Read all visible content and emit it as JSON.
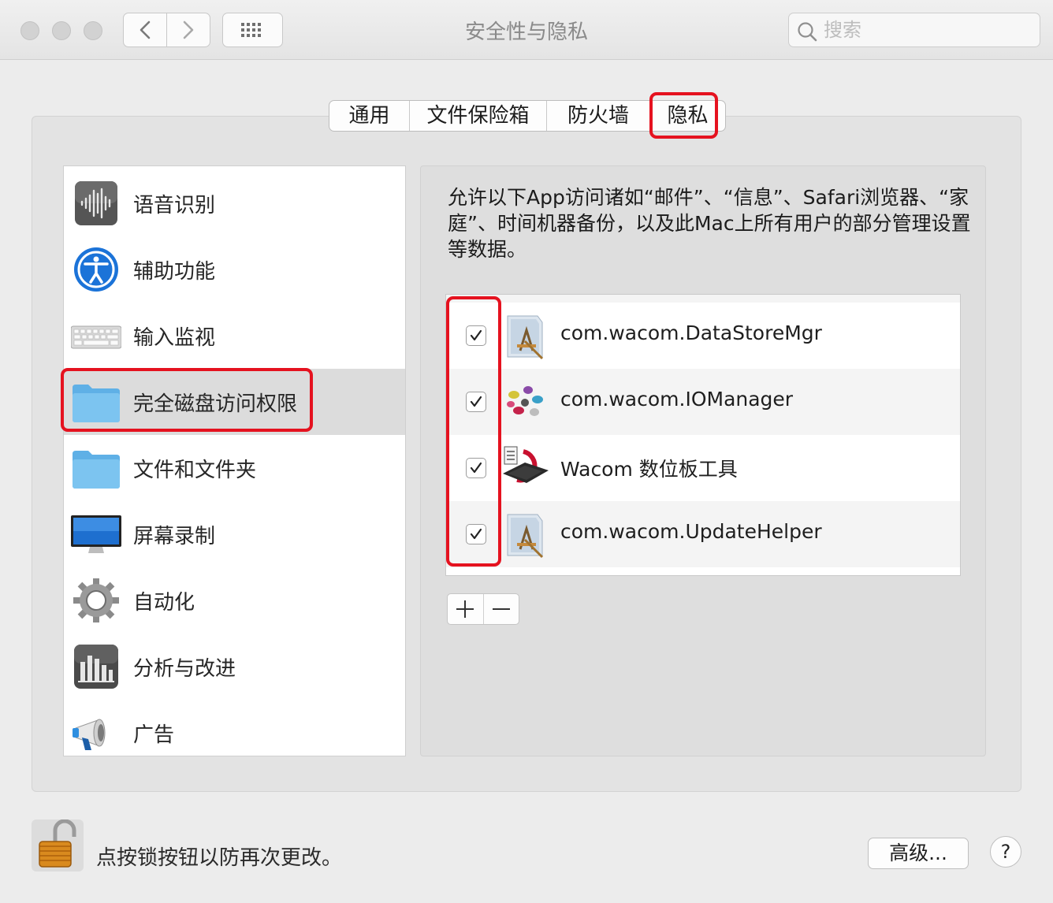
{
  "window": {
    "title": "安全性与隐私",
    "search_placeholder": "搜索"
  },
  "tabs": [
    {
      "label": "通用"
    },
    {
      "label": "文件保险箱"
    },
    {
      "label": "防火墙"
    },
    {
      "label": "隐私",
      "selected": true
    }
  ],
  "sidebar": {
    "items": [
      {
        "label": "语音识别",
        "icon": "speech-waveform-icon"
      },
      {
        "label": "辅助功能",
        "icon": "accessibility-icon"
      },
      {
        "label": "输入监视",
        "icon": "keyboard-icon"
      },
      {
        "label": "完全磁盘访问权限",
        "icon": "folder-icon",
        "selected": true
      },
      {
        "label": "文件和文件夹",
        "icon": "folder-icon"
      },
      {
        "label": "屏幕录制",
        "icon": "display-icon"
      },
      {
        "label": "自动化",
        "icon": "gear-icon"
      },
      {
        "label": "分析与改进",
        "icon": "bar-chart-icon"
      },
      {
        "label": "广告",
        "icon": "megaphone-icon"
      }
    ]
  },
  "main": {
    "description": "允许以下App访问诸如“邮件”、“信息”、Safari浏览器、“家庭”、时间机器备份，以及此Mac上所有用户的部分管理设置等数据。",
    "apps": [
      {
        "name": "com.wacom.DataStoreMgr",
        "checked": true,
        "icon": "generic-app-icon"
      },
      {
        "name": "com.wacom.IOManager",
        "checked": true,
        "icon": "iomanager-icon"
      },
      {
        "name": "Wacom 数位板工具",
        "checked": true,
        "icon": "tablet-utility-icon"
      },
      {
        "name": "com.wacom.UpdateHelper",
        "checked": true,
        "icon": "generic-app-icon"
      }
    ],
    "add_label": "+",
    "remove_label": "−"
  },
  "footer": {
    "lock_text": "点按锁按钮以防再次更改。",
    "advanced_label": "高级...",
    "help_label": "?"
  },
  "colors": {
    "highlight_red": "#e5121f",
    "selected_row": "#dcdcdc",
    "folder_blue": "#7cc4f0"
  }
}
